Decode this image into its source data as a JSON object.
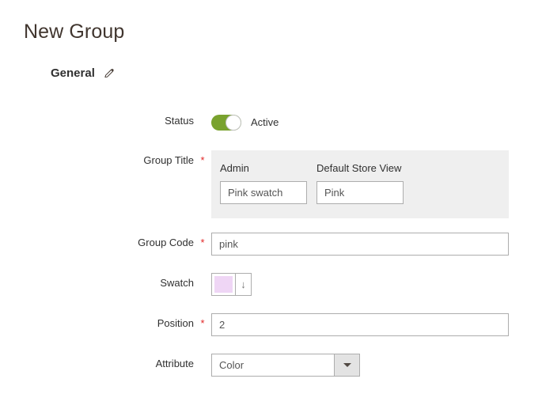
{
  "page": {
    "title": "New Group"
  },
  "section": {
    "heading": "General",
    "edit_icon": "pencil-icon"
  },
  "form": {
    "status": {
      "label": "Status",
      "toggle_state": "on",
      "state_text": "Active",
      "toggle_color": "#79a22e"
    },
    "group_title": {
      "label": "Group Title",
      "required": "*",
      "stores": [
        {
          "label": "Admin",
          "value": "Pink swatch"
        },
        {
          "label": "Default Store View",
          "value": "Pink"
        }
      ]
    },
    "group_code": {
      "label": "Group Code",
      "required": "*",
      "value": "pink"
    },
    "swatch": {
      "label": "Swatch",
      "color": "#efd6f5",
      "picker_icon": "↓"
    },
    "position": {
      "label": "Position",
      "required": "*",
      "value": "2"
    },
    "attribute": {
      "label": "Attribute",
      "value": "Color",
      "dropdown_icon": "chevron-down-icon"
    }
  }
}
